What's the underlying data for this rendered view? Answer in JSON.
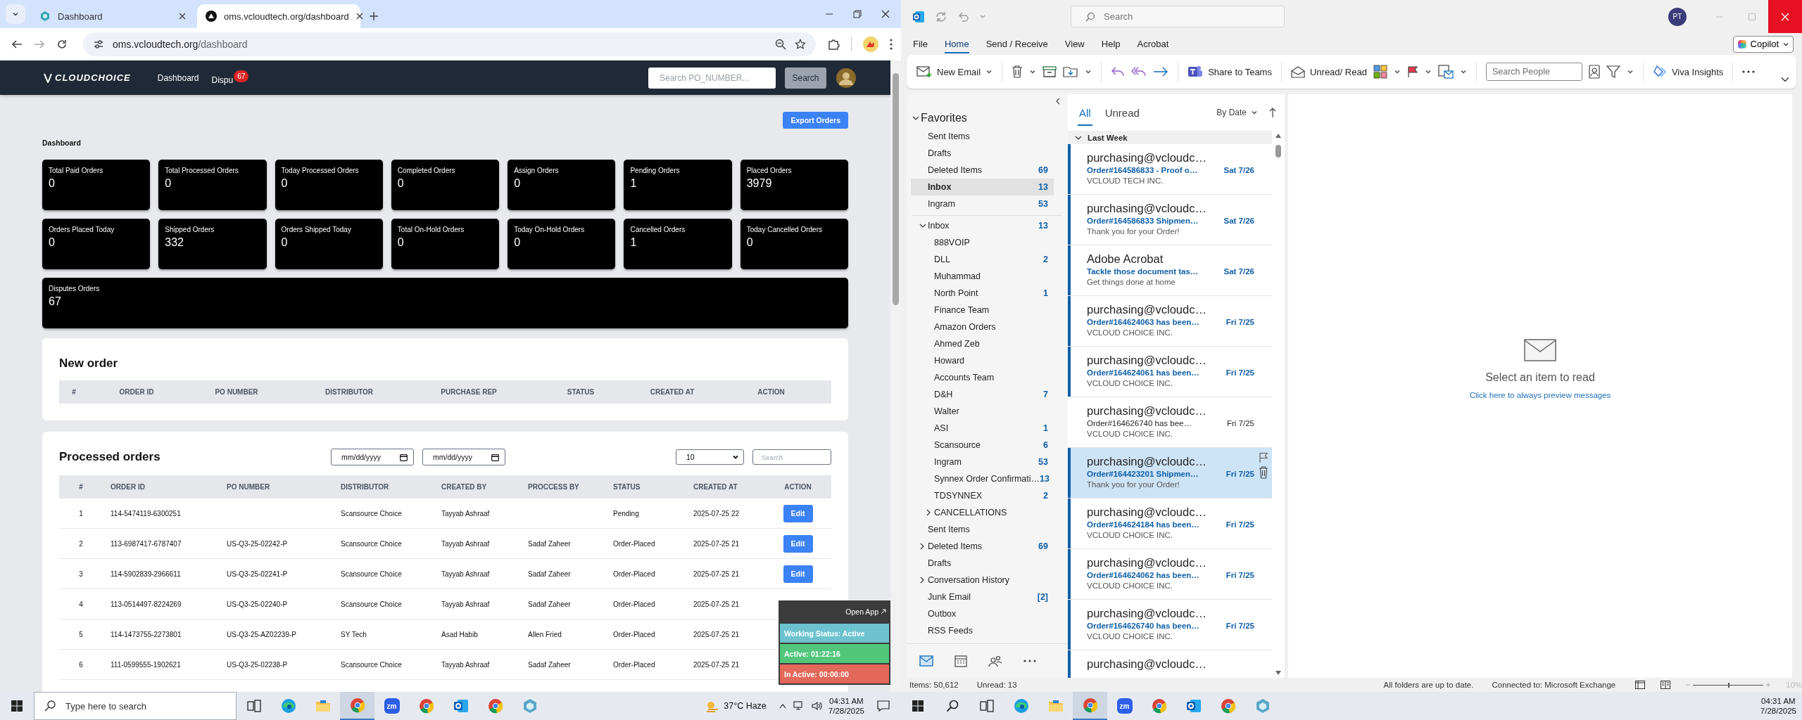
{
  "browser": {
    "tabs": [
      {
        "title": "Dashboard",
        "selected": false
      },
      {
        "title": "oms.vcloudtech.org/dashboard",
        "selected": true
      }
    ],
    "url_host": "oms.vcloudtech.org",
    "url_path": "/dashboard"
  },
  "oms": {
    "logo": "CLOUDCHOICE",
    "nav": [
      {
        "label": "Dashboard"
      },
      {
        "label": "Dispu",
        "badge": "67"
      }
    ],
    "header_search": {
      "placeholder": "Search PO_NUMBER..."
    },
    "search_button": "Search",
    "export_button": "Export Orders",
    "title": "Dashboard",
    "stats": [
      {
        "kind": "card",
        "label": "Total Paid Orders",
        "value": "0"
      },
      {
        "kind": "card",
        "label": "Total Processed Orders",
        "value": "0"
      },
      {
        "kind": "card",
        "label": "Today Processed Orders",
        "value": "0"
      },
      {
        "kind": "card",
        "label": "Completed Orders",
        "value": "0"
      },
      {
        "kind": "card",
        "label": "Assign Orders",
        "value": "0"
      },
      {
        "kind": "card",
        "label": "Pending Orders",
        "value": "1"
      },
      {
        "kind": "card",
        "label": "Placed Orders",
        "value": "3979"
      },
      {
        "kind": "card",
        "label": "Orders Placed Today",
        "value": "0"
      },
      {
        "kind": "card",
        "label": "Shipped Orders",
        "value": "332"
      },
      {
        "kind": "card",
        "label": "Orders Shipped Today",
        "value": "0"
      },
      {
        "kind": "card",
        "label": "Total On-Hold Orders",
        "value": "0"
      },
      {
        "kind": "card",
        "label": "Today On-Hold Orders",
        "value": "0"
      },
      {
        "kind": "card",
        "label": "Cancelled Orders",
        "value": "1"
      },
      {
        "kind": "card",
        "label": "Today Cancelled Orders",
        "value": "0"
      },
      {
        "kind": "wide",
        "label": "Disputes Orders",
        "value": "67"
      }
    ],
    "new_order": {
      "title": "New order",
      "columns": [
        "#",
        "ORDER ID",
        "PO NUMBER",
        "DISTRIBUTOR",
        "PURCHASE REP",
        "STATUS",
        "CREATED AT",
        "ACTION"
      ]
    },
    "processed": {
      "title": "Processed orders",
      "date_filters": [
        {
          "placeholder": "mm/dd/yyyy"
        },
        {
          "placeholder": "mm/dd/yyyy"
        }
      ],
      "page_size": "10",
      "search": {
        "placeholder": "Search"
      },
      "columns": [
        "#",
        "ORDER ID",
        "PO NUMBER",
        "DISTRIBUTOR",
        "CREATED BY",
        "PROCCESS BY",
        "STATUS",
        "CREATED AT",
        "ACTION"
      ],
      "rows": [
        {
          "num": "1",
          "order_id": "114-5474119-6300251",
          "distributor": "Scansource Choice",
          "created_by": "Tayyab Ashraaf",
          "status": "Pending",
          "created_at": "2025-07-25 22",
          "action": "Edit"
        },
        {
          "num": "2",
          "order_id": "113-6987417-6787407",
          "po_number": "US-Q3-25-02242-P",
          "distributor": "Scansource Choice",
          "created_by": "Tayyab Ashraaf",
          "processed_by": "Sadaf Zaheer",
          "status": "Order-Placed",
          "created_at": "2025-07-25 21",
          "action": "Edit"
        },
        {
          "num": "3",
          "order_id": "114-5902839-2966611",
          "po_number": "US-Q3-25-02241-P",
          "distributor": "Scansource Choice",
          "created_by": "Tayyab Ashraaf",
          "processed_by": "Sadaf Zaheer",
          "status": "Order-Placed",
          "created_at": "2025-07-25 21",
          "action": "Edit"
        },
        {
          "num": "4",
          "order_id": "113-0514497-8224269",
          "po_number": "US-Q3-25-02240-P",
          "distributor": "Scansource Choice",
          "created_by": "Tayyab Ashraaf",
          "processed_by": "Sadaf Zaheer",
          "status": "Order-Placed",
          "created_at": "2025-07-25 21"
        },
        {
          "num": "5",
          "order_id": "114-1473755-2273801",
          "po_number": "US-Q3-25-AZ02239-P",
          "distributor": "SY Tech",
          "created_by": "Asad Habib",
          "processed_by": "Allen Fried",
          "status": "Order-Placed",
          "created_at": "2025-07-25 21"
        },
        {
          "num": "6",
          "order_id": "111-0599555-1902621",
          "po_number": "US-Q3-25-02238-P",
          "distributor": "Scansource Choice",
          "created_by": "Tayyab Ashraaf",
          "processed_by": "Sadaf Zaheer",
          "status": "Order-Placed",
          "created_at": "2025-07-25 21"
        }
      ]
    },
    "widget": {
      "link": "Open App",
      "rows": [
        {
          "text": "Working Status: Active",
          "color": "#6cc3cf"
        },
        {
          "text": "Active: 01:22:16",
          "color": "#52c77c"
        },
        {
          "text": "In Active: 00:00:00",
          "color": "#e3685a"
        }
      ]
    }
  },
  "outlook": {
    "search_placeholder": "Search",
    "avatar": "PT",
    "menu": [
      {
        "label": "File",
        "selected": false
      },
      {
        "label": "Home",
        "selected": true
      },
      {
        "label": "Send / Receive",
        "selected": false
      },
      {
        "label": "View",
        "selected": false
      },
      {
        "label": "Help",
        "selected": false
      },
      {
        "label": "Acrobat",
        "selected": false
      }
    ],
    "copilot": "Copilot",
    "ribbon": {
      "new_email": "New Email",
      "share": "Share to Teams",
      "unread": "Unread/ Read",
      "search_people": "Search People",
      "viva": "Viva Insights"
    },
    "folders": {
      "favorites": {
        "label": "Favorites",
        "expanded": true,
        "items": [
          {
            "name": "Sent Items",
            "selected": false
          },
          {
            "name": "Drafts",
            "selected": false
          },
          {
            "name": "Deleted Items",
            "count": "69",
            "selected": false
          },
          {
            "name": "Inbox",
            "count": "13",
            "selected": true
          },
          {
            "name": "Ingram",
            "count": "53",
            "selected": false
          }
        ]
      },
      "mailbox": [
        {
          "name": "Inbox",
          "count": "13",
          "expanded": true,
          "selected": false,
          "children": [
            {
              "name": "888VOIP",
              "selected": false
            },
            {
              "name": "DLL",
              "count": "2",
              "selected": false
            },
            {
              "name": "Muhammad",
              "selected": false
            },
            {
              "name": "North Point",
              "count": "1",
              "selected": false
            },
            {
              "name": "Finance Team",
              "selected": false
            },
            {
              "name": "Amazon Orders",
              "selected": false
            },
            {
              "name": "Ahmed Zeb",
              "selected": false
            },
            {
              "name": "Howard",
              "selected": false
            },
            {
              "name": "Accounts Team",
              "selected": false
            },
            {
              "name": "D&H",
              "count": "7",
              "selected": false
            },
            {
              "name": "Walter",
              "selected": false
            },
            {
              "name": "ASI",
              "count": "1",
              "selected": false
            },
            {
              "name": "Scansource",
              "count": "6",
              "selected": false
            },
            {
              "name": "Ingram",
              "count": "53",
              "selected": false
            },
            {
              "name": "Synnex Order Confirmati…",
              "count": "13",
              "selected": false
            },
            {
              "name": "TDSYNNEX",
              "count": "2",
              "selected": false
            },
            {
              "name": "CANCELLATIONS",
              "expanded": false,
              "selected": false
            }
          ]
        },
        {
          "name": "Sent Items",
          "selected": false
        },
        {
          "name": "Deleted Items",
          "count": "69",
          "expanded": false,
          "selected": false
        },
        {
          "name": "Drafts",
          "selected": false
        },
        {
          "name": "Conversation History",
          "expanded": false,
          "selected": false
        },
        {
          "name": "Junk Email",
          "count": "[2]",
          "selected": false
        },
        {
          "name": "Outbox",
          "selected": false
        },
        {
          "name": "RSS Feeds",
          "selected": false
        }
      ]
    },
    "list": {
      "filters": [
        {
          "label": "All",
          "selected": true
        },
        {
          "label": "Unread",
          "selected": false
        }
      ],
      "sort": "By Date",
      "group": "Last Week",
      "messages": [
        {
          "sender": "purchasing@vcloudc…",
          "subject": "Order#164586833 - Proof o…",
          "preview": "VCLOUD TECH INC.",
          "date": "Sat 7/26",
          "unread": true,
          "selected": false
        },
        {
          "sender": "purchasing@vcloudc…",
          "subject": "Order#164586833 Shipmen…",
          "preview": "Thank you for your Order!",
          "date": "Sat 7/26",
          "unread": true,
          "selected": false
        },
        {
          "sender": "Adobe Acrobat",
          "subject": "Tackle those document tas…",
          "preview": "Get things done at home",
          "date": "Sat 7/26",
          "unread": true,
          "selected": false
        },
        {
          "sender": "purchasing@vcloudc…",
          "subject": "Order#164624063 has been…",
          "preview": "VCLOUD CHOICE INC.",
          "date": "Fri 7/25",
          "unread": true,
          "selected": false
        },
        {
          "sender": "purchasing@vcloudc…",
          "subject": "Order#164624061 has been…",
          "preview": "VCLOUD CHOICE INC.",
          "date": "Fri 7/25",
          "unread": true,
          "selected": false
        },
        {
          "sender": "purchasing@vcloudc…",
          "subject": "Order#164626740 has bee…",
          "preview": "VCLOUD CHOICE INC.",
          "date": "Fri 7/25",
          "unread": false,
          "selected": false
        },
        {
          "sender": "purchasing@vcloudc…",
          "subject": "Order#164423201 Shipmen…",
          "preview": "Thank you for your Order!",
          "date": "Fri 7/25",
          "unread": true,
          "selected": true
        },
        {
          "sender": "purchasing@vcloudc…",
          "subject": "Order#164624184 has been…",
          "preview": "VCLOUD CHOICE INC.",
          "date": "Fri 7/25",
          "unread": true,
          "selected": false
        },
        {
          "sender": "purchasing@vcloudc…",
          "subject": "Order#164624062 has been…",
          "preview": "VCLOUD CHOICE INC.",
          "date": "Fri 7/25",
          "unread": true,
          "selected": false
        },
        {
          "sender": "purchasing@vcloudc…",
          "subject": "Order#164626740 has been…",
          "preview": "VCLOUD CHOICE INC.",
          "date": "Fri 7/25",
          "unread": true,
          "selected": false
        },
        {
          "sender": "purchasing@vcloudc…",
          "unread": true,
          "selected": false
        }
      ]
    },
    "reading": {
      "message": "Select an item to read",
      "link": "Click here to always preview messages"
    },
    "status": {
      "items": "Items: 50,612",
      "unread": "Unread: 13",
      "sync": "All folders are up to date.",
      "connection": "Connected to: Microsoft Exchange",
      "zoom": "10%",
      "zoom_slider": {
        "level": 0.5
      }
    }
  },
  "taskbar": {
    "left": {
      "search_placeholder": "Type here to search",
      "apps": [
        {
          "kind": "taskview",
          "active": false
        },
        {
          "kind": "edge",
          "active": false
        },
        {
          "kind": "files",
          "active": false
        },
        {
          "kind": "chrome",
          "active": true
        },
        {
          "kind": "zoom",
          "label": "zm",
          "active": false
        },
        {
          "kind": "chrome",
          "active": false
        },
        {
          "kind": "outlook",
          "active": false
        },
        {
          "kind": "chrome",
          "active": false
        },
        {
          "kind": "app",
          "active": false
        }
      ],
      "weather": "37°C Haze",
      "time": "04:31 AM",
      "date": "7/28/2025"
    },
    "right": {
      "apps": [
        {
          "kind": "search",
          "active": false
        },
        {
          "kind": "taskview",
          "active": false
        },
        {
          "kind": "edge",
          "active": false
        },
        {
          "kind": "files",
          "active": false
        },
        {
          "kind": "chrome",
          "active": true
        },
        {
          "kind": "zoom",
          "label": "zm",
          "active": false
        },
        {
          "kind": "chrome",
          "active": false
        },
        {
          "kind": "outlook",
          "active": false
        },
        {
          "kind": "chrome",
          "active": false
        },
        {
          "kind": "app",
          "active": false
        }
      ],
      "time": "04:31 AM",
      "date": "7/28/2025"
    }
  }
}
